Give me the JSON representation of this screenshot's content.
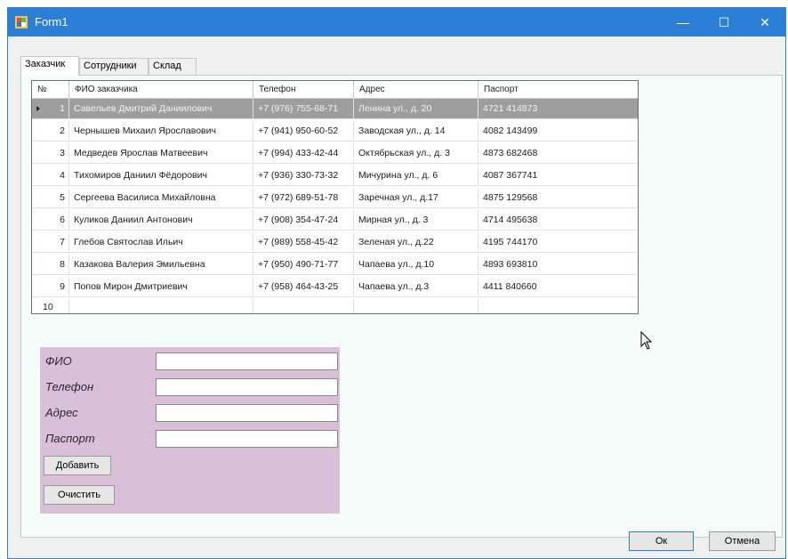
{
  "window": {
    "title": "Form1",
    "minimize": "—",
    "maximize": "☐",
    "close": "✕"
  },
  "tabs": [
    "Заказчик",
    "Сотрудники",
    "Склад"
  ],
  "grid": {
    "columns": [
      "№",
      "ФИО заказчика",
      "Телефон",
      "Адрес",
      "Паспорт"
    ],
    "rows": [
      {
        "n": "1",
        "fio": "Савельев Дмитрий Даниилович",
        "phone": "+7 (976) 755-68-71",
        "address": "Ленина ул., д. 20",
        "passport": "4721 414873"
      },
      {
        "n": "2",
        "fio": "Чернышев Михаил Ярославович",
        "phone": "+7 (941) 950-60-52",
        "address": "Заводская ул., д. 14",
        "passport": "4082 143499"
      },
      {
        "n": "3",
        "fio": "Медведев Ярослав Матвеевич",
        "phone": "+7 (994) 433-42-44",
        "address": "Октябрьская ул., д. 3",
        "passport": "4873 682468"
      },
      {
        "n": "4",
        "fio": "Тихомиров Даниил Фёдорович",
        "phone": "+7 (936) 330-73-32",
        "address": "Мичурина ул., д. 6",
        "passport": "4087 367741"
      },
      {
        "n": "5",
        "fio": "Сергеева Василиса Михайловна",
        "phone": "+7 (972) 689-51-78",
        "address": "Заречная ул., д.17",
        "passport": "4875 129568"
      },
      {
        "n": "6",
        "fio": "Куликов Даниил Антонович",
        "phone": "+7 (908) 354-47-24",
        "address": "Мирная ул., д. 3",
        "passport": "4714 495638"
      },
      {
        "n": "7",
        "fio": "Глебов Святослав Ильич",
        "phone": "+7 (989) 558-45-42",
        "address": "Зеленая ул., д.22",
        "passport": "4195 744170"
      },
      {
        "n": "8",
        "fio": "Казакова Валерия Эмильевна",
        "phone": "+7 (950) 490-71-77",
        "address": "Чапаева ул., д.10",
        "passport": "4893 693810"
      },
      {
        "n": "9",
        "fio": "Попов Мирон Дмитриевич",
        "phone": "+7 (958) 464-43-25",
        "address": "Чапаева ул., д.3",
        "passport": "4411 840660"
      }
    ],
    "new_row_number": "10"
  },
  "form": {
    "fio_label": "ФИО",
    "phone_label": "Телефон",
    "address_label": "Адрес",
    "passport_label": "Паспорт",
    "fio_value": "",
    "phone_value": "",
    "address_value": "",
    "passport_value": "",
    "add_button": "Добавить",
    "clear_button": "Очистить"
  },
  "footer": {
    "ok_button": "Ок",
    "cancel_button": "Отмена"
  },
  "colors": {
    "titlebar": "#2b7fd6",
    "form_panel": "#d9bfd8",
    "selected_row": "#9e9e9e",
    "tab_page": "#f4fbf9"
  }
}
